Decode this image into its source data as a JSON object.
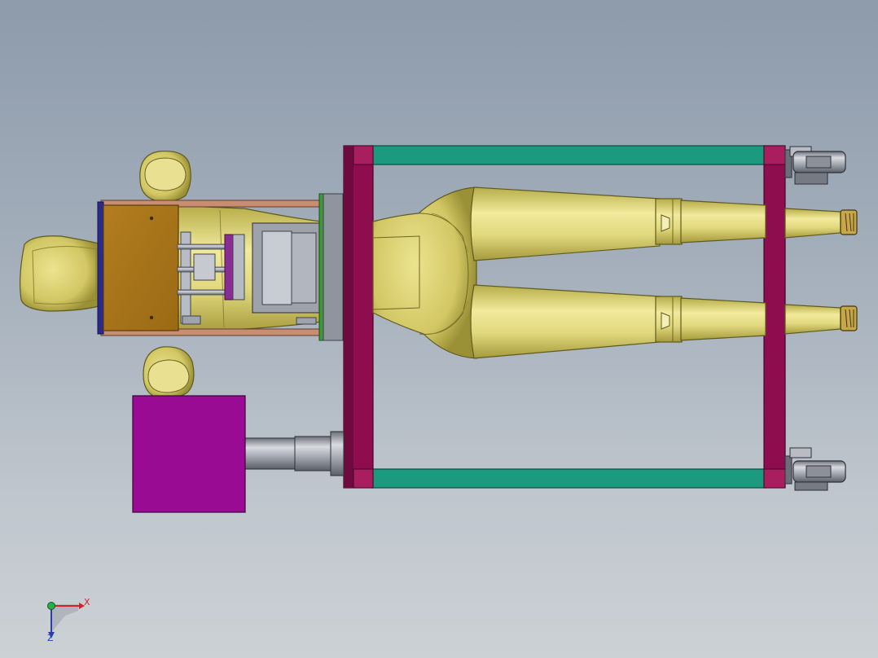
{
  "viewport": {
    "background_top": "#8d9bab",
    "background_bottom": "#ccd1d5"
  },
  "colors": {
    "frame_rail": "#1b9a80",
    "frame_post": "#8e0d4f",
    "frame_corner": "#a81e5e",
    "body_yellow": "#d8cf6e",
    "body_yellow_dark": "#9c9337",
    "seat_wood": "#a8741a",
    "motor_box": "#980b92",
    "steel": "#9ea3ad",
    "green_plate": "#3d9b3a",
    "blue_plate": "#2a2a8a"
  },
  "orientation_triad": {
    "x_label": "X",
    "z_label": "Z",
    "x_color": "#d8202a",
    "z_color": "#2a3eb0",
    "y_color": "#24b04a"
  }
}
